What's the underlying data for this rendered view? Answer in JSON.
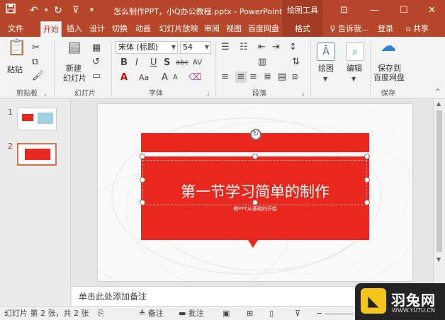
{
  "titlebar": {
    "title": "怎么制作PPT，小Q办公教程.pptx - PowerPoint",
    "context_tab": "绘图工具",
    "save_icon": "save-icon",
    "undo_icon": "undo-icon",
    "redo_icon": "redo-icon",
    "present_icon": "present-icon"
  },
  "tabs": [
    "文件",
    "开始",
    "插入",
    "设计",
    "切换",
    "动画",
    "幻灯片放映",
    "审阅",
    "视图",
    "百度网盘"
  ],
  "format_tab": "格式",
  "tellme": "告诉我...",
  "login": "登录",
  "share": "共享",
  "ribbon": {
    "paste": "粘贴",
    "new_slide_1": "新建",
    "new_slide_2": "幻灯片",
    "font_name": "宋体 (标题)",
    "font_size": "54",
    "drawing": "绘图",
    "editing": "编辑",
    "save_to_1": "保存到",
    "save_to_2": "百度网盘",
    "groups": {
      "clipboard": "剪贴板",
      "slides": "幻灯片",
      "font": "字体",
      "paragraph": "段落",
      "save": "保存"
    }
  },
  "slides": [
    {
      "number": "1"
    },
    {
      "number": "2"
    }
  ],
  "slide": {
    "title": "第一节学习简单的制作",
    "subtitle": "做PPT从基础的开始"
  },
  "notes_placeholder": "单击此处添加备注",
  "statusbar": {
    "slide_info": "幻灯片 第 2 张，共 2 张",
    "notes": "备注",
    "comments": "批注"
  },
  "watermark": {
    "name": "羽兔网",
    "url": "WWW.YUTU.CN"
  },
  "colors": {
    "accent": "#b7472a",
    "slide_red": "#e8281c"
  }
}
